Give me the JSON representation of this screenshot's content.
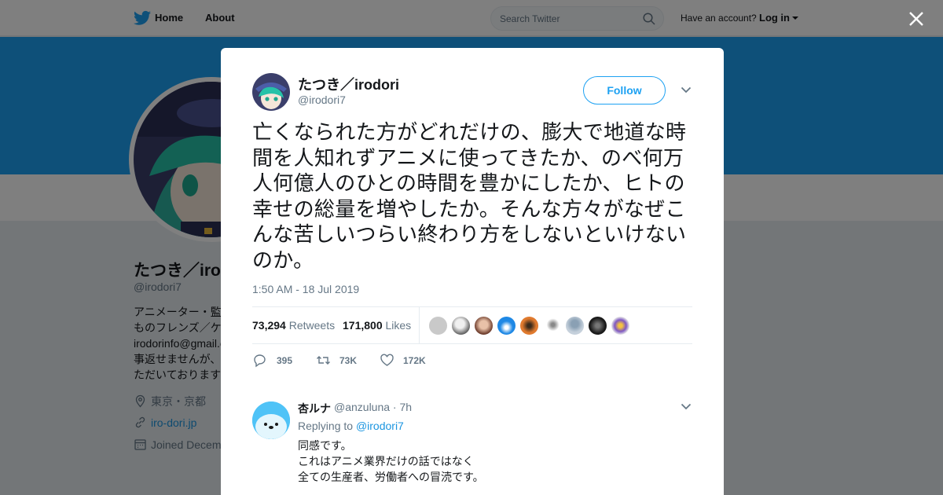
{
  "nav": {
    "home_label": "Home",
    "about_label": "About",
    "search_placeholder": "Search Twitter",
    "have_account": "Have an account?",
    "login_label": "Log in"
  },
  "profile": {
    "name": "たつき／irodori",
    "handle": "@irodori7",
    "bio": "アニメーター・監\nものフレンズ／ケ\nirodorinfo@gmail.c\n事返せませんが、\nただいております",
    "location": "東京・京都",
    "website": "iro-dori.jp",
    "joined": "Joined Decem"
  },
  "tweet": {
    "author_name": "たつき／irodori",
    "author_handle": "@irodori7",
    "follow_label": "Follow",
    "text": "亡くなられた方がどれだけの、膨大で地道な時間を人知れずアニメに使ってきたか、のべ何万人何億人のひとの時間を豊かにしたか、ヒトの幸せの総量を増やしたか。そんな方々がなぜこんな苦しいつらい終わり方をしないといけないのか。",
    "timestamp": "1:50 AM - 18 Jul 2019",
    "retweets_count": "73,294",
    "retweets_label": "Retweets",
    "likes_count": "171,800",
    "likes_label": "Likes",
    "replies_action": "395",
    "retweets_action": "73K",
    "likes_action": "172K"
  },
  "reply": {
    "name": "杏ルナ",
    "handle": "@anzuluna",
    "time": "7h",
    "replying_prefix": "Replying to",
    "replying_to": "@irodori7",
    "text": "同感です。\nこれはアニメ業界だけの話ではなく\n全ての生産者、労働者への冒涜です。"
  },
  "colors": {
    "brand": "#1da1f2",
    "link": "#1b95e0",
    "muted": "#657786",
    "text": "#14171a"
  }
}
